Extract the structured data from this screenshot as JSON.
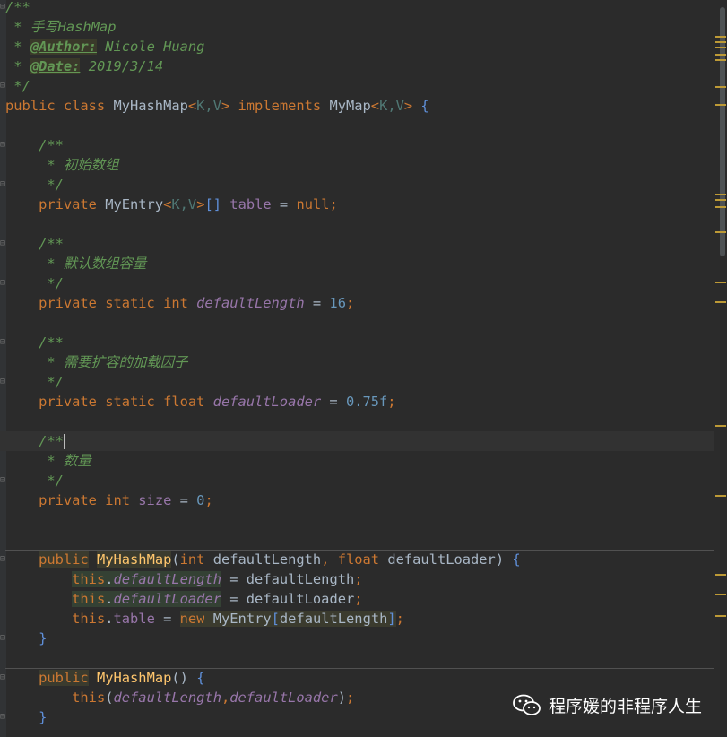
{
  "editor": {
    "language": "Java",
    "comment_title": "手写HashMap",
    "author_tag": "@Author:",
    "author_name": "Nicole Huang",
    "date_tag": "@Date:",
    "date_value": "2019/3/14",
    "class_name": "MyHashMap",
    "interface_name": "MyMap",
    "type_params": "K,V",
    "comment_table": "初始数组",
    "comment_length": "默认数组容量",
    "comment_loader": "需要扩容的加载因子",
    "comment_size": "数量",
    "entry_type": "MyEntry",
    "field_table": "table",
    "field_length": "defaultLength",
    "field_loader": "defaultLoader",
    "field_size": "size",
    "value_length": "16",
    "value_loader": "0.75f",
    "value_size": "0",
    "param_length": "defaultLength",
    "param_loader": "defaultLoader"
  },
  "watermark": {
    "text": "程序媛的非程序人生",
    "icon": "wechat-icon"
  },
  "colors": {
    "background": "#2b2b2b",
    "keyword": "#cc7832",
    "comment": "#629755",
    "field": "#9876aa",
    "number": "#6897bb",
    "method": "#ffc66d",
    "type_param": "#507874"
  }
}
